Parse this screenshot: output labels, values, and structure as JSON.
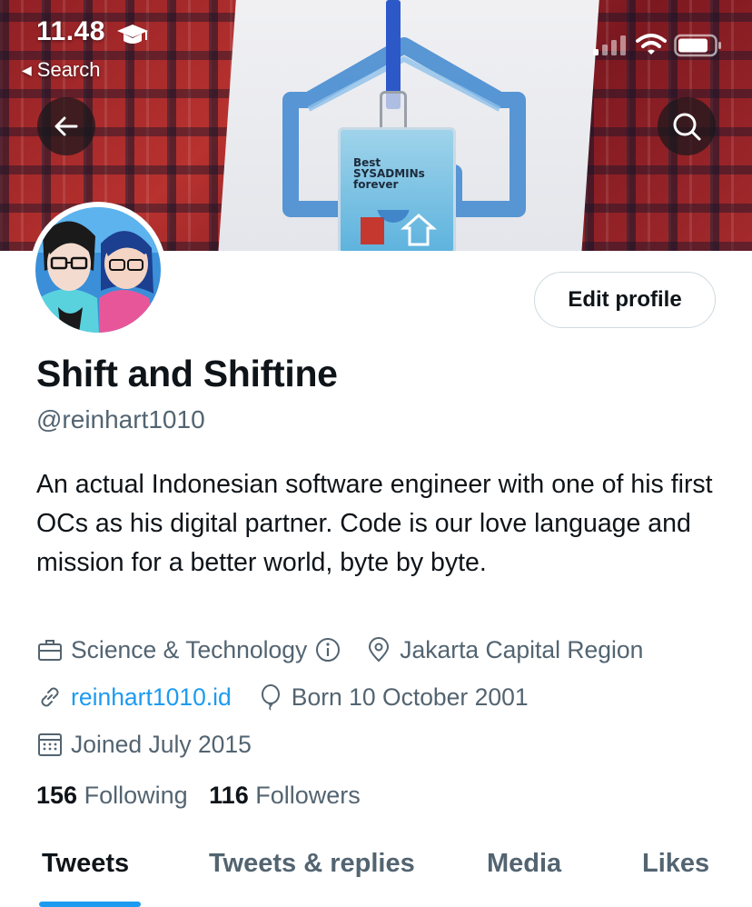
{
  "status_bar": {
    "time": "11.48",
    "back_to_app": "Search",
    "icons": [
      "graduation-cap-icon",
      "signal-icon",
      "wifi-icon",
      "battery-icon"
    ]
  },
  "banner": {
    "badge_text": [
      "Best",
      "SYSADMINs",
      "forever"
    ]
  },
  "header": {
    "edit_profile_label": "Edit profile"
  },
  "profile": {
    "name": "Shift and Shiftine",
    "handle": "@reinhart1010",
    "bio": "An actual Indonesian software engineer with one of his first OCs as his digital partner. Code is our love language and mission for a better world, byte by byte.",
    "category": "Science & Technology",
    "location": "Jakarta Capital Region",
    "website": "reinhart1010.id",
    "born": "Born 10 October 2001",
    "joined": "Joined July 2015",
    "following_count": "156",
    "following_label": "Following",
    "followers_count": "116",
    "followers_label": "Followers"
  },
  "tabs": [
    {
      "label": "Tweets",
      "active": true
    },
    {
      "label": "Tweets & replies",
      "active": false
    },
    {
      "label": "Media",
      "active": false
    },
    {
      "label": "Likes",
      "active": false
    }
  ],
  "colors": {
    "accent": "#1d9bf0",
    "text_primary": "#0f1419",
    "text_secondary": "#536471",
    "border": "#cfd9de"
  }
}
